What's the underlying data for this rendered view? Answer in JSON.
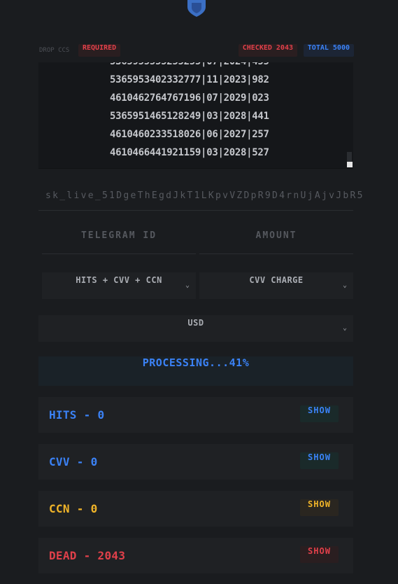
{
  "colors": {
    "accent": "#3b82f6",
    "danger": "#e0404a",
    "warn": "#f0b429",
    "bg": "#1a1c1f"
  },
  "header": {
    "drop_label": "DROP CCS",
    "required_badge": "REQUIRED",
    "checked_badge": "CHECKED 2043",
    "total_badge": "TOTAL 5000"
  },
  "cards_textarea": {
    "lines": [
      "5365953402332777|11|2023|982",
      "4610462764767196|07|2029|023",
      "5365951465128249|03|2028|441",
      "4610460233518026|06|2027|257",
      "4610466441921159|03|2028|527"
    ]
  },
  "sk_field": {
    "value": "sk_live_51DgeThEgdJkT1LKpvVZDpR9D4rnUjAjvJbR5"
  },
  "telegram_field": {
    "placeholder": "TELEGRAM ID"
  },
  "amount_field": {
    "placeholder": "AMOUNT"
  },
  "selects": {
    "mode": {
      "selected": "HITS + CVV + CCN",
      "icon": "chevron-down-icon"
    },
    "charge": {
      "selected": "CVV CHARGE",
      "icon": "chevron-down-icon"
    },
    "currency": {
      "selected": "USD",
      "icon": "chevron-down-icon"
    }
  },
  "status": {
    "text": "PROCESSING...41%",
    "progress": 0.41
  },
  "results": [
    {
      "label": "HITS - 0",
      "show": "SHOW",
      "color": "#3b82f6",
      "btn_bg": "#1a2a2a",
      "btn_color": "#3b82f6"
    },
    {
      "label": "CVV - 0",
      "show": "SHOW",
      "color": "#3b82f6",
      "btn_bg": "#1a2a2a",
      "btn_color": "#3b82f6"
    },
    {
      "label": "CCN - 0",
      "show": "SHOW",
      "color": "#f0b429",
      "btn_bg": "#2a2620",
      "btn_color": "#f0b429"
    },
    {
      "label": "DEAD - 2043",
      "show": "SHOW",
      "color": "#e0404a",
      "btn_bg": "#2a1e20",
      "btn_color": "#e0404a"
    }
  ]
}
